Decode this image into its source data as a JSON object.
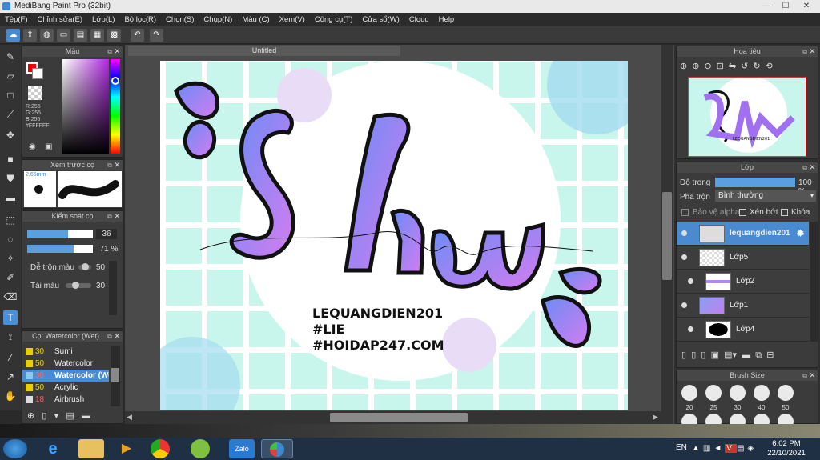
{
  "window": {
    "title": "MediBang Paint Pro (32bit)",
    "min": "—",
    "max": "☐",
    "close": "✕"
  },
  "menu": [
    "Tệp(F)",
    "Chỉnh sửa(E)",
    "Lớp(L)",
    "Bộ lọc(R)",
    "Chọn(S)",
    "Chụp(N)",
    "Màu (C)",
    "Xem(V)",
    "Công cụ(T)",
    "Cửa sổ(W)",
    "Cloud",
    "Help"
  ],
  "color_panel": {
    "title": "Màu",
    "r": "R:255",
    "g": "G:255",
    "b": "B:255",
    "hex": "#FFFFFF"
  },
  "preview_panel": {
    "title": "Xem trước cọ",
    "size": "2.65mm"
  },
  "control_panel": {
    "title": "Kiểm soát cọ",
    "size_value": "36",
    "opacity_value": "71 %",
    "mix_label": "Dễ trộn màu",
    "mix_value": "50",
    "color_amount_label": "Tải màu",
    "color_amount_value": "30"
  },
  "brush_panel": {
    "title": "Cọ: Watercolor (Wet)",
    "items": [
      {
        "size": "30",
        "name": "Sumi"
      },
      {
        "size": "50",
        "name": "Watercolor"
      },
      {
        "size": "30",
        "name": "Watercolor (Wet)"
      },
      {
        "size": "50",
        "name": "Acrylic"
      },
      {
        "size": "18",
        "name": "Airbrush"
      }
    ]
  },
  "document": {
    "tab": "Untitled"
  },
  "canvas_text": {
    "line1": "LEQUANGDIEN201",
    "line2": "#LIE",
    "line3": "#HOIDAP247.COM",
    "script": "Shu"
  },
  "navigator": {
    "title": "Hoa tiêu"
  },
  "layers_panel": {
    "title": "Lớp",
    "opacity_label": "Độ trong",
    "opacity_value": "100 %",
    "blend_label": "Pha trộn",
    "blend_value": "Bình thường",
    "protect_alpha": "Bảo vệ alpha",
    "clip": "Xén bớt",
    "lock": "Khóa",
    "layers": [
      "lequangdien201",
      "Lớp5",
      "Lớp2",
      "Lớp1",
      "Lớp4"
    ]
  },
  "brush_size_panel": {
    "title": "Brush Size",
    "sizes": [
      "20",
      "25",
      "30",
      "40",
      "50"
    ]
  },
  "taskbar": {
    "lang": "EN",
    "time": "6:02 PM",
    "date": "22/10/2021"
  },
  "colors": {
    "accent": "#4a8ad0",
    "canvas_bg": "#c9f6ec",
    "lettering": "#9a6af0"
  }
}
